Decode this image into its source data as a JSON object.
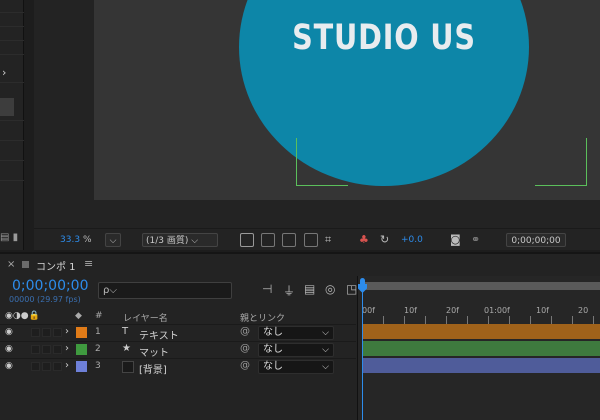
{
  "viewer": {
    "comp_text": "STUDIO US",
    "colors": {
      "circle": "#0d86a8",
      "title_safe": "#5bbf5b",
      "accent": "#2d8ceb"
    }
  },
  "viewer_toolbar": {
    "zoom_value": "33.3",
    "zoom_unit": "%",
    "resolution": "(1/3 画質)",
    "exposure": "+0.0",
    "current_time": "0;00;00;00"
  },
  "timeline": {
    "tab_label": "コンポ 1",
    "timecode": "0;00;00;00",
    "fps": "00000 (29.97 fps)",
    "search_placeholder": "ρ⌵",
    "columns": {
      "hash": "#",
      "layer_name": "レイヤー名",
      "parent": "親とリンク"
    },
    "ruler_labels": [
      "00f",
      "10f",
      "20f",
      "01:00f",
      "10f",
      "20"
    ],
    "layers": [
      {
        "num": "1",
        "type_icon": "T",
        "name": "テキスト",
        "label_color": "#e07b18",
        "bar_color": "#a0621a",
        "parent": "なし"
      },
      {
        "num": "2",
        "type_icon": "★",
        "name": "マット",
        "label_color": "#3f9a3f",
        "bar_color": "#3e7a3e",
        "parent": "なし"
      },
      {
        "num": "3",
        "type_icon": "",
        "name": "[背景]",
        "label_color": "#6e80d8",
        "bar_color": "#4f5c9a",
        "parent": "なし"
      }
    ]
  }
}
